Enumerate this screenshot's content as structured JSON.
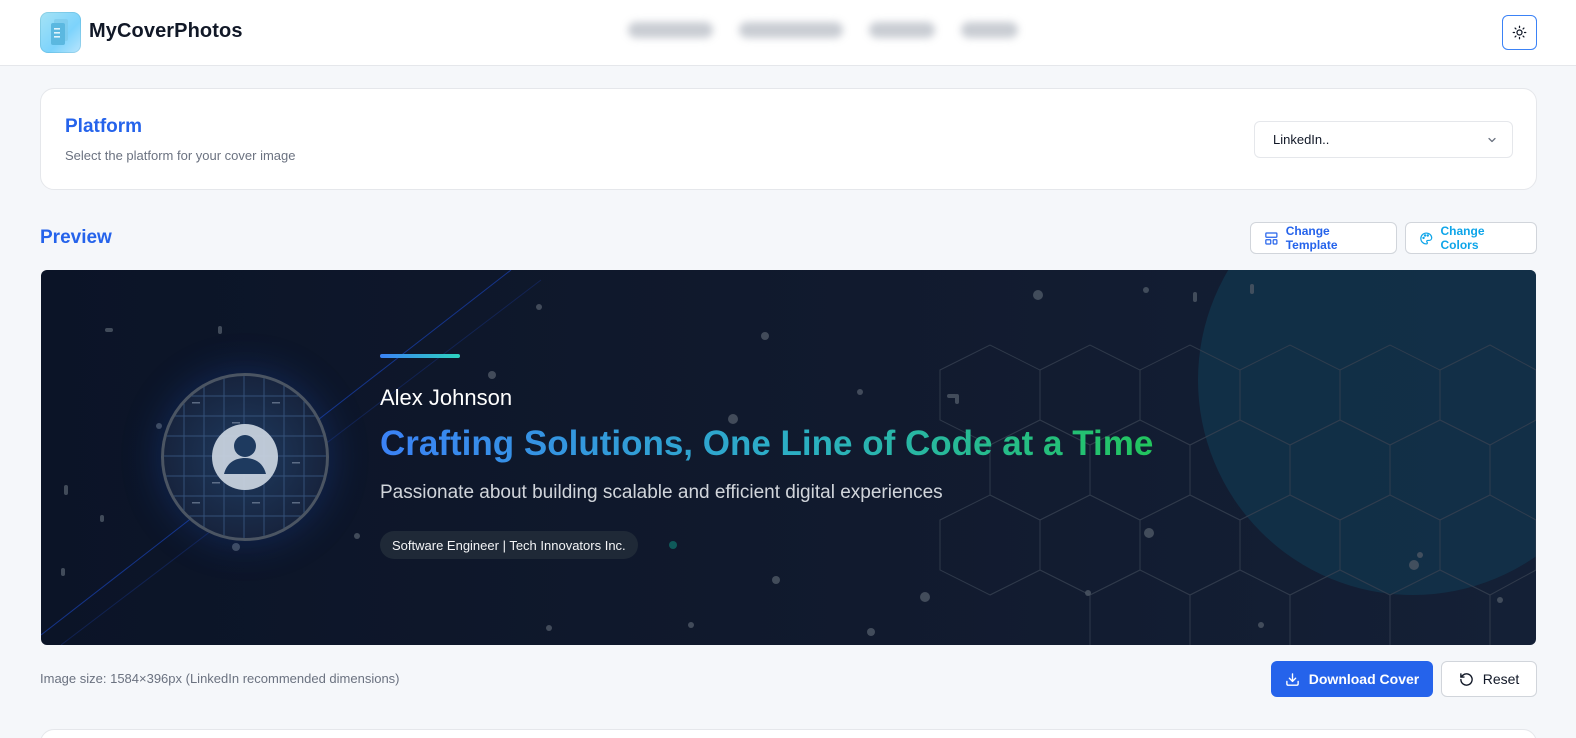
{
  "header": {
    "brand": "MyCoverPhotos",
    "logo_icon": "document-stack-icon",
    "theme_icon": "sun-icon"
  },
  "platform": {
    "title": "Platform",
    "subtitle": "Select the platform for your cover image",
    "selected": "LinkedIn.."
  },
  "preview": {
    "title": "Preview",
    "change_template": "Change Template",
    "change_colors": "Change Colors"
  },
  "cover": {
    "name": "Alex Johnson",
    "headline": "Crafting Solutions, One Line of Code at a Time",
    "tagline": "Passionate about building scalable and efficient digital experiences",
    "badge": "Software Engineer | Tech Innovators Inc.",
    "colors": {
      "background": "#0f172a",
      "accent_start": "#3b82f6",
      "accent_end": "#22c55e"
    }
  },
  "footer": {
    "image_size": "Image size: 1584×396px (LinkedIn recommended dimensions)",
    "download": "Download Cover",
    "reset": "Reset"
  }
}
